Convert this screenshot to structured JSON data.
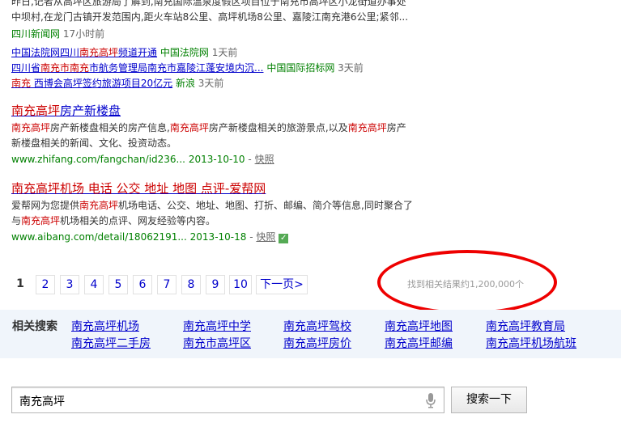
{
  "results_top": {
    "snippet_line1": "昨日,记者从高坪区旅游局了解到,南充国际温泉度假区项目位于南充市高坪区小龙街道办事处",
    "snippet_line2": "中坝村,在龙门古镇开发范围内,距火车站8公里、高坪机场8公里、嘉陵江南充港6公里;紧邻...",
    "source": "四川新闻网",
    "time": "17小时前",
    "news": [
      {
        "title_pre": "中国法院网四川",
        "title_em": "南充高坪",
        "title_post": "频道开通",
        "source": "中国法院网",
        "time": "1天前"
      },
      {
        "title_pre": "四川省",
        "title_em": "南充市南充",
        "title_post": "市航务管理局南充市嘉陵江蓬安境内沉...",
        "source": "中国国际招标网",
        "time": "3天前"
      },
      {
        "title_pre": "",
        "title_em": "南充",
        "title_post": " 西博会高坪签约旅游项目20亿元",
        "source": "新浪",
        "time": "3天前"
      }
    ]
  },
  "result2": {
    "title_em": "南充高坪",
    "title_post": "房产新楼盘",
    "line1_a": "南充高坪",
    "line1_b": "房产新楼盘相关的房产信息,",
    "line1_c": "南充高坪",
    "line1_d": "房产新楼盘相关的旅游景点,以及",
    "line1_e": "南充高坪",
    "line1_f": "房产",
    "line2": "新楼盘相关的新闻、文化、投资动态。",
    "url": "www.zhifang.com/fangchan/id236...",
    "date": "2013-10-10",
    "snapshot": "快照"
  },
  "result3": {
    "title": "南充高坪机场 电话 公交 地址 地图 点评-爱帮网",
    "line1_a": "爱帮网为您提供",
    "line1_b": "南充高坪",
    "line1_c": "机场电话、公交、地址、地图、打折、邮编、简介等信息,同时聚合了",
    "line2_a": "与",
    "line2_b": "南充高坪",
    "line2_c": "机场相关的点评、网友经验等内容。",
    "url": "www.aibang.com/detail/18062191...",
    "date": "2013-10-18",
    "snapshot": "快照",
    "check": "✓"
  },
  "pagination": {
    "current": "1",
    "pages": [
      "2",
      "3",
      "4",
      "5",
      "6",
      "7",
      "8",
      "9",
      "10"
    ],
    "next": "下一页>",
    "result_count": "找到相关结果约1,200,000个"
  },
  "related": {
    "label": "相关搜索",
    "items": [
      [
        "南充高坪机场",
        "南充高坪中学",
        "南充高坪驾校",
        "南充高坪地图",
        "南充高坪教育局"
      ],
      [
        "南充高坪二手房",
        "南充市高坪区",
        "南充高坪房价",
        "南充高坪邮编",
        "南充高坪机场航班"
      ]
    ]
  },
  "search": {
    "query": "南充高坪",
    "button": "搜索一下",
    "mic_icon": "microphone-icon"
  },
  "colors": {
    "link": "#0000cc",
    "highlight": "#cc0000",
    "green": "#008000",
    "annotation": "#ee0000"
  }
}
